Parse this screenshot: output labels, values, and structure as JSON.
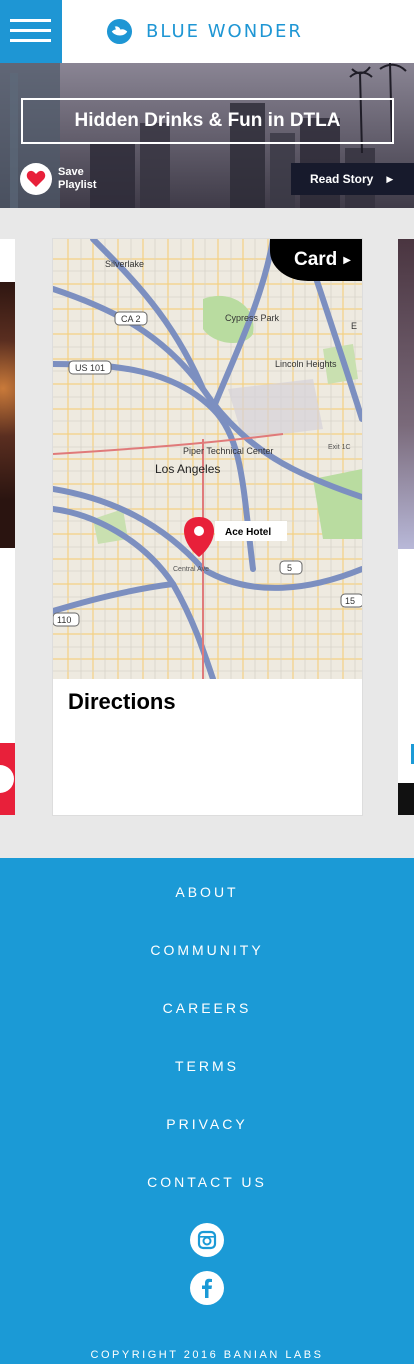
{
  "header": {
    "brand": "BLUE WONDER",
    "menu_icon": "hamburger-menu-icon",
    "logo_icon": "bird-logo-icon"
  },
  "hero": {
    "title": "Hidden Drinks & Fun in DTLA",
    "save_label": "Save Playlist",
    "read_story_label": "Read Story",
    "heart_color": "#e8203a"
  },
  "card": {
    "tag_label": "Card",
    "directions_title": "Directions",
    "map": {
      "pin_label": "Ace Hotel",
      "labels": {
        "silverlake": "Silverlake",
        "cypress_park": "Cypress Park",
        "lincoln_heights": "Lincoln Heights",
        "piper": "Piper Technical Center",
        "los_angeles": "Los Angeles",
        "central_ave": "Central Ave",
        "exit": "Exit 1C",
        "east": "E"
      },
      "shields": {
        "ca2": "CA 2",
        "us101": "US 101",
        "i5": "5",
        "i5b": "15",
        "i10": "110"
      }
    }
  },
  "footer": {
    "links": [
      "ABOUT",
      "COMMUNITY",
      "CAREERS",
      "TERMS",
      "PRIVACY",
      "CONTACT US"
    ],
    "copyright": "COPYRIGHT 2016 BANIAN LABS"
  },
  "colors": {
    "brand_blue": "#1e96d4",
    "footer_blue": "#1b9ad6",
    "accent_red": "#e8203a"
  }
}
